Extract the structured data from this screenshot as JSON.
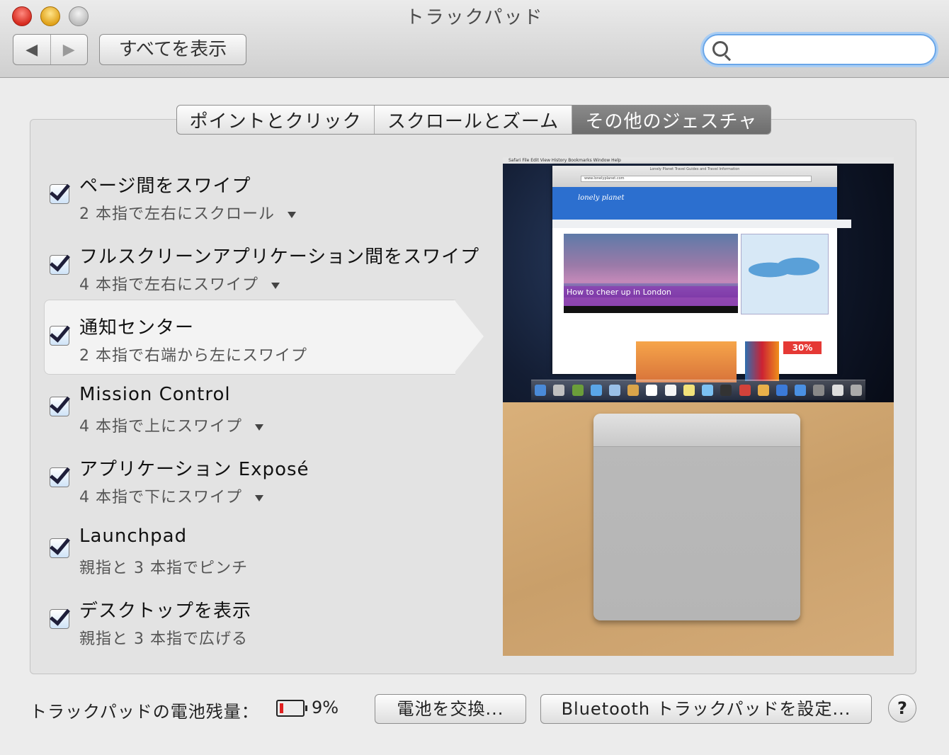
{
  "window": {
    "title": "トラックパッド"
  },
  "toolbar": {
    "back_icon": "◀",
    "forward_icon": "▶",
    "show_all": "すべてを表示",
    "search_placeholder": ""
  },
  "tabs": [
    {
      "label": "ポイントとクリック"
    },
    {
      "label": "スクロールとズーム"
    },
    {
      "label": "その他のジェスチャ",
      "selected": true
    }
  ],
  "gestures": [
    {
      "title": "ページ間をスワイプ",
      "desc": "2 本指で左右にスクロール",
      "checked": true,
      "has_menu": true
    },
    {
      "title": "フルスクリーンアプリケーション間をスワイプ",
      "desc": "4 本指で左右にスワイプ",
      "checked": true,
      "has_menu": true
    },
    {
      "title": "通知センター",
      "desc": "2 本指で右端から左にスワイプ",
      "checked": true,
      "has_menu": false,
      "selected": true
    },
    {
      "title": "Mission Control",
      "desc": "4 本指で上にスワイプ",
      "checked": true,
      "has_menu": true
    },
    {
      "title": "アプリケーション Exposé",
      "desc": "4 本指で下にスワイプ",
      "checked": true,
      "has_menu": true
    },
    {
      "title": "Launchpad",
      "desc": "親指と 3 本指でピンチ",
      "checked": true,
      "has_menu": false
    },
    {
      "title": "デスクトップを表示",
      "desc": "親指と 3 本指で広げる",
      "checked": true,
      "has_menu": false
    }
  ],
  "preview": {
    "menubar": "Safari   File   Edit   View   History   Bookmarks   Window   Help",
    "browser_title": "Lonely Planet Travel Guides and Travel Information",
    "url": "www.lonelyplanet.com",
    "logo": "lonely planet",
    "hero_caption": "How to cheer up in London",
    "sale": "30%"
  },
  "footer": {
    "battery_label": "トラックパッドの電池残量：",
    "battery_percent": "9%",
    "replace_button": "電池を交換...",
    "bluetooth_button": "Bluetooth トラックパッドを設定...",
    "help": "?"
  },
  "colors": {
    "selected_tab": "#7a7a7a",
    "battery_low": "#e02020",
    "search_focus": "#6aa6e8"
  }
}
